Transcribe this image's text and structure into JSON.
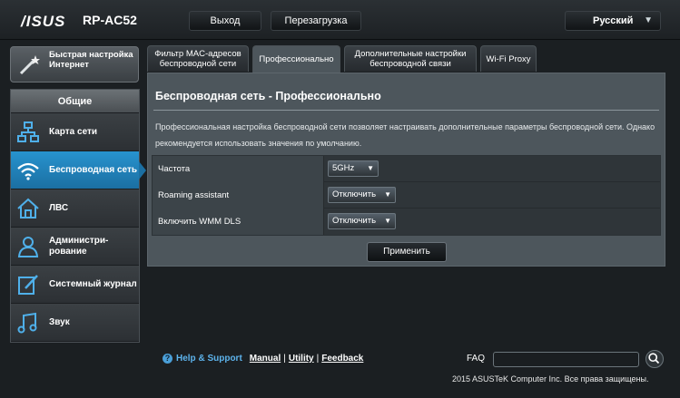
{
  "header": {
    "brand": "/ISUS",
    "model": "RP-AC52",
    "logout_label": "Выход",
    "reboot_label": "Перезагрузка",
    "language": "Русский"
  },
  "sidebar": {
    "quick_setup": "Быстрая настройка Интернет",
    "section_title": "Общие",
    "items": [
      {
        "label": "Карта сети",
        "icon": "network-map-icon"
      },
      {
        "label": "Беспроводная сеть",
        "icon": "wifi-icon",
        "active": true
      },
      {
        "label": "ЛВС",
        "icon": "home-icon"
      },
      {
        "label": "Администри-рование",
        "icon": "admin-user-icon"
      },
      {
        "label": "Системный журнал",
        "icon": "log-edit-icon"
      },
      {
        "label": "Звук",
        "icon": "music-note-icon"
      }
    ]
  },
  "tabs": [
    {
      "label": "Фильтр MAC-адресов беспроводной сети"
    },
    {
      "label": "Профессионально",
      "active": true
    },
    {
      "label": "Дополнительные настройки беспроводной связи"
    },
    {
      "label": "Wi-Fi Proxy"
    }
  ],
  "main": {
    "title": "Беспроводная сеть - Профессионально",
    "description": "Профессиональная настройка беспроводной сети позволяет настраивать дополнительные параметры беспроводной сети. Однако рекомендуется использовать значения по умолчанию.",
    "settings": [
      {
        "label": "Частота",
        "value": "5GHz"
      },
      {
        "label": "Roaming assistant",
        "value": "Отключить"
      },
      {
        "label": "Включить WMM DLS",
        "value": "Отключить"
      }
    ],
    "apply_label": "Применить"
  },
  "footer": {
    "help_label": "Help & Support",
    "manual_label": "Manual",
    "utility_label": "Utility",
    "feedback_label": "Feedback",
    "faq_label": "FAQ",
    "faq_placeholder": "",
    "copyright": "2015 ASUSTeK Computer Inc. Все права защищены."
  },
  "colors": {
    "accent": "#1b6fa2",
    "panel": "#4d565c",
    "help": "#5db3ec"
  }
}
